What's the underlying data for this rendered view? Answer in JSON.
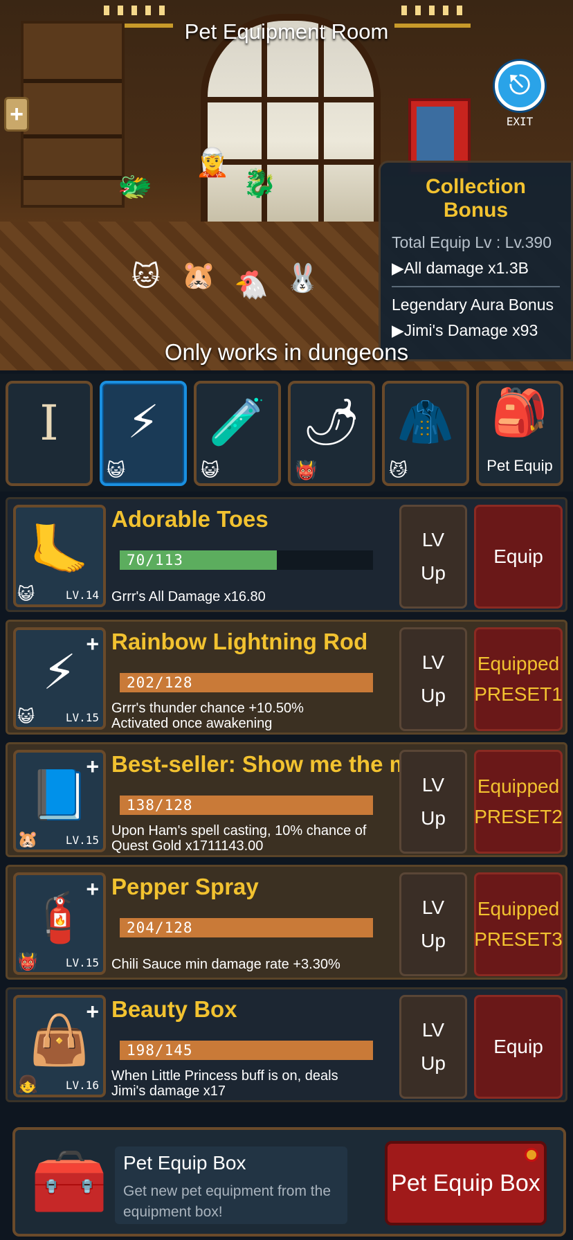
{
  "room": {
    "title": "Pet Equipment Room",
    "plus_label": "+",
    "exit_label": "EXIT",
    "note": "Only works in dungeons"
  },
  "collection_bonus": {
    "title": "Collection Bonus",
    "total_equip": "Total Equip Lv : Lv.390",
    "all_damage": "▶All damage x1.3B",
    "legendary_title": "Legendary Aura Bonus",
    "legendary_effect": "▶Jimi's Damage x93"
  },
  "tabs": [
    {
      "id": "book",
      "icon": "I",
      "icon_name": "book-icon",
      "badge": "",
      "label": ""
    },
    {
      "id": "lightning-rod",
      "icon": "⚡",
      "icon_name": "lightning-rod-icon",
      "badge": "😺",
      "label": "",
      "selected": true
    },
    {
      "id": "potion",
      "icon": "🧪",
      "icon_name": "potion-icon",
      "badge": "😺",
      "label": ""
    },
    {
      "id": "pepper",
      "icon": "🌶",
      "icon_name": "pepper-icon",
      "badge": "👹",
      "label": ""
    },
    {
      "id": "suit",
      "icon": "🧥",
      "icon_name": "suit-icon",
      "badge": "😼",
      "label": ""
    },
    {
      "id": "pet-equip",
      "icon": "🎒",
      "icon_name": "backpack-icon",
      "badge": "",
      "label": "Pet Equip"
    }
  ],
  "items": [
    {
      "name": "Adorable Toes",
      "icon": "🦶",
      "badge": "😺",
      "level": "LV.14",
      "exp": "70/113",
      "exp_current": 70,
      "exp_max": 113,
      "desc": "Grrr's All Damage x16.80",
      "lvup_line1": "LV",
      "lvup_line2": "Up",
      "button_line1": "Equip",
      "button_line2": "",
      "equipped": false,
      "has_plus": false
    },
    {
      "name": "Rainbow Lightning Rod",
      "icon": "⚡",
      "badge": "😺",
      "level": "LV.15",
      "exp": "202/128",
      "exp_current": 202,
      "exp_max": 128,
      "desc": "Grrr's thunder chance +10.50%\nActivated once awakening",
      "lvup_line1": "LV",
      "lvup_line2": "Up",
      "button_line1": "Equipped",
      "button_line2": "PRESET1",
      "equipped": true,
      "has_plus": true
    },
    {
      "name": "Best-seller: Show me the money",
      "icon": "📘",
      "badge": "🐹",
      "level": "LV.15",
      "exp": "138/128",
      "exp_current": 138,
      "exp_max": 128,
      "desc": "Upon Ham's spell casting, 10% chance of\nQuest Gold x1711143.00",
      "lvup_line1": "LV",
      "lvup_line2": "Up",
      "button_line1": "Equipped",
      "button_line2": "PRESET2",
      "equipped": true,
      "has_plus": true
    },
    {
      "name": "Pepper Spray",
      "icon": "🧯",
      "badge": "👹",
      "level": "LV.15",
      "exp": "204/128",
      "exp_current": 204,
      "exp_max": 128,
      "desc": "Chili Sauce min damage rate +3.30%",
      "lvup_line1": "LV",
      "lvup_line2": "Up",
      "button_line1": "Equipped",
      "button_line2": "PRESET3",
      "equipped": true,
      "has_plus": true
    },
    {
      "name": "Beauty Box",
      "icon": "👜",
      "badge": "👧",
      "level": "LV.16",
      "exp": "198/145",
      "exp_current": 198,
      "exp_max": 145,
      "desc": "When Little Princess buff is on, deals\nJimi's damage x17",
      "lvup_line1": "LV",
      "lvup_line2": "Up",
      "button_line1": "Equip",
      "button_line2": "",
      "equipped": false,
      "has_plus": true
    }
  ],
  "box": {
    "chest_icon": "🧰",
    "title": "Pet Equip Box",
    "desc": "Get new pet equipment from the equipment box!",
    "button_label": "Pet Equip Box"
  }
}
